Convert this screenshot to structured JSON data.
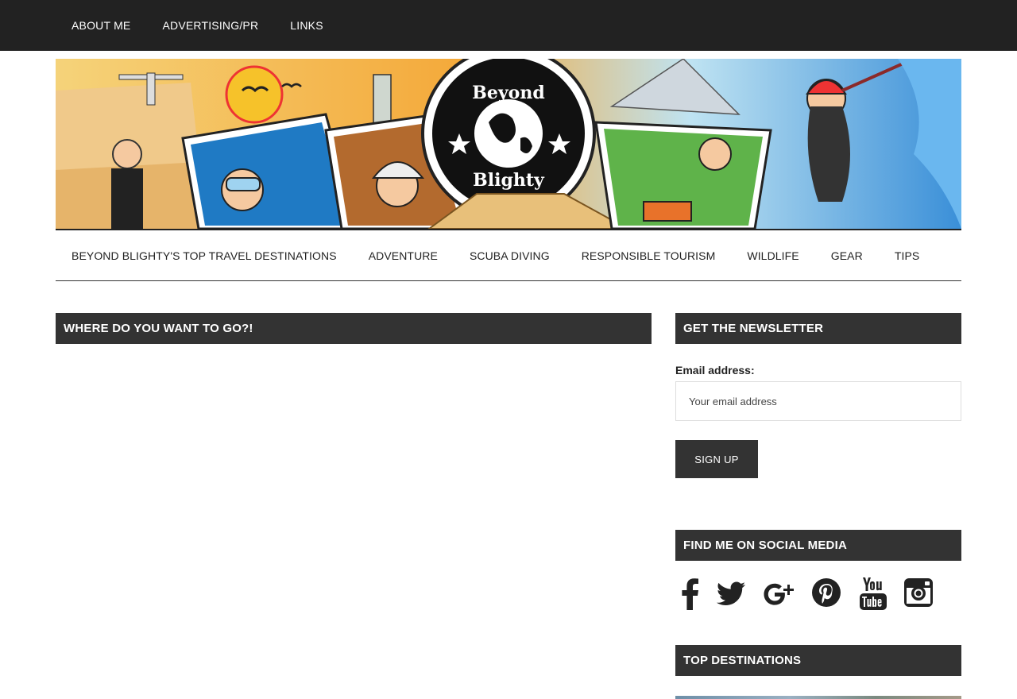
{
  "top_nav": {
    "items": [
      "ABOUT ME",
      "ADVERTISING/PR",
      "LINKS"
    ]
  },
  "banner": {
    "logo_line1": "Beyond",
    "logo_line2": "Blighty"
  },
  "main_nav": {
    "items": [
      "BEYOND BLIGHTY'S TOP TRAVEL DESTINATIONS",
      "ADVENTURE",
      "SCUBA DIVING",
      "RESPONSIBLE TOURISM",
      "WILDLIFE",
      "GEAR",
      "TIPS"
    ]
  },
  "content": {
    "widget_title": "WHERE DO YOU WANT TO GO?!"
  },
  "sidebar": {
    "newsletter": {
      "title": "GET THE NEWSLETTER",
      "email_label": "Email address:",
      "email_placeholder": "Your email address",
      "email_value": "",
      "submit_label": "SIGN UP"
    },
    "social": {
      "title": "FIND ME ON SOCIAL MEDIA",
      "icons": [
        "facebook-icon",
        "twitter-icon",
        "google-plus-icon",
        "pinterest-icon",
        "youtube-icon",
        "instagram-icon"
      ]
    },
    "destinations": {
      "title": "TOP DESTINATIONS"
    }
  },
  "colors": {
    "topbar_bg": "#222222",
    "widget_title_bg": "#333333",
    "button_bg": "#333333",
    "text_dark": "#222222"
  }
}
